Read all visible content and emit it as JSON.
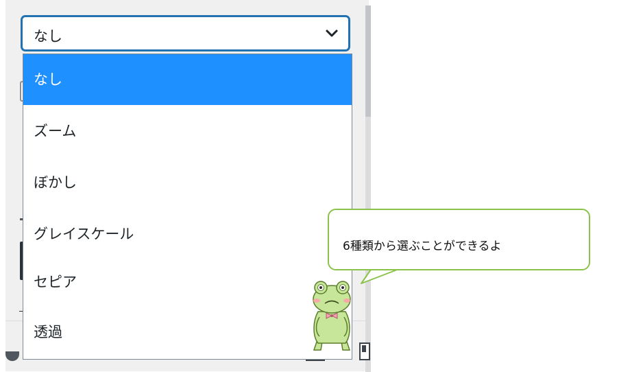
{
  "select": {
    "value": "なし"
  },
  "dropdown": {
    "options": [
      "なし",
      "ズーム",
      "ぼかし",
      "グレイスケール",
      "セピア",
      "透過"
    ],
    "selected_index": 0
  },
  "speech_bubble": {
    "text": "6種類から選ぶことができるよ"
  },
  "icons": {
    "chevron": "chevron-down-icon",
    "mascot": "frog-mascot-icon"
  },
  "colors": {
    "accent": "#2271b1",
    "selected_option_bg": "#1e90ff",
    "bubble_border": "#8bc34a",
    "panel_bg": "#f0f0f1"
  }
}
